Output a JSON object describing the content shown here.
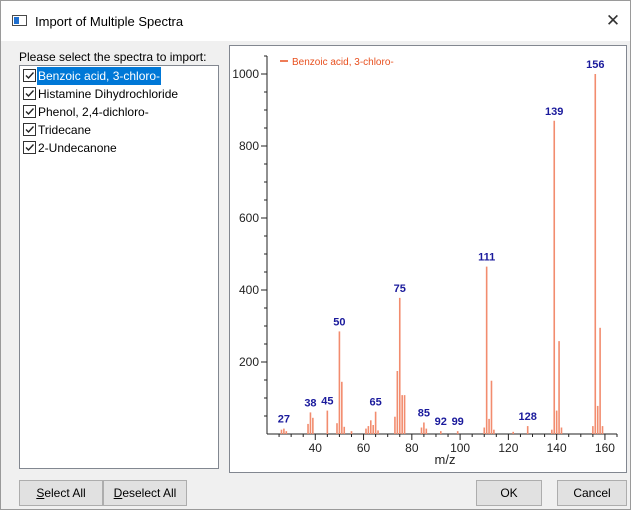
{
  "window": {
    "title": "Import of Multiple Spectra",
    "close_glyph": "✕"
  },
  "prompt": "Please select the spectra to import:",
  "spectra": [
    {
      "label": "Benzoic acid, 3-chloro-",
      "checked": true,
      "selected": true
    },
    {
      "label": "Histamine Dihydrochloride",
      "checked": true,
      "selected": false
    },
    {
      "label": "Phenol, 2,4-dichloro-",
      "checked": true,
      "selected": false
    },
    {
      "label": "Tridecane",
      "checked": true,
      "selected": false
    },
    {
      "label": "2-Undecanone",
      "checked": true,
      "selected": false
    }
  ],
  "buttons": {
    "select_all": {
      "accel": "S",
      "rest": "elect All"
    },
    "deselect_all": {
      "accel": "D",
      "rest": "eselect All"
    },
    "ok": "OK",
    "cancel": "Cancel"
  },
  "colors": {
    "accent": "#0078d7",
    "peak": "#f28c6e",
    "peak_label": "#1a1a9c",
    "legend": "#e8501f"
  },
  "chart_data": {
    "type": "bar",
    "legend": "Benzoic acid, 3-chloro-",
    "legend_placement": "top-left",
    "xlabel": "m/z",
    "ylabel": "",
    "xlim": [
      20,
      165
    ],
    "ylim": [
      0,
      1050
    ],
    "xticks": [
      40,
      60,
      80,
      100,
      120,
      140,
      160
    ],
    "yticks": [
      200,
      400,
      600,
      800,
      1000
    ],
    "grid": false,
    "peaks": [
      {
        "x": 26,
        "y": 12
      },
      {
        "x": 27,
        "y": 15
      },
      {
        "x": 28,
        "y": 8
      },
      {
        "x": 37,
        "y": 28
      },
      {
        "x": 38,
        "y": 60
      },
      {
        "x": 39,
        "y": 45
      },
      {
        "x": 45,
        "y": 65
      },
      {
        "x": 49,
        "y": 30
      },
      {
        "x": 50,
        "y": 285
      },
      {
        "x": 51,
        "y": 145
      },
      {
        "x": 52,
        "y": 20
      },
      {
        "x": 55,
        "y": 8
      },
      {
        "x": 61,
        "y": 15
      },
      {
        "x": 62,
        "y": 22
      },
      {
        "x": 63,
        "y": 38
      },
      {
        "x": 64,
        "y": 25
      },
      {
        "x": 65,
        "y": 62
      },
      {
        "x": 66,
        "y": 10
      },
      {
        "x": 73,
        "y": 48
      },
      {
        "x": 74,
        "y": 175
      },
      {
        "x": 75,
        "y": 378
      },
      {
        "x": 76,
        "y": 108
      },
      {
        "x": 77,
        "y": 108
      },
      {
        "x": 84,
        "y": 18
      },
      {
        "x": 85,
        "y": 32
      },
      {
        "x": 86,
        "y": 15
      },
      {
        "x": 92,
        "y": 8
      },
      {
        "x": 99,
        "y": 8
      },
      {
        "x": 110,
        "y": 18
      },
      {
        "x": 111,
        "y": 465
      },
      {
        "x": 112,
        "y": 42
      },
      {
        "x": 113,
        "y": 148
      },
      {
        "x": 114,
        "y": 12
      },
      {
        "x": 122,
        "y": 6
      },
      {
        "x": 128,
        "y": 22
      },
      {
        "x": 138,
        "y": 12
      },
      {
        "x": 139,
        "y": 870
      },
      {
        "x": 140,
        "y": 65
      },
      {
        "x": 141,
        "y": 258
      },
      {
        "x": 142,
        "y": 18
      },
      {
        "x": 155,
        "y": 22
      },
      {
        "x": 156,
        "y": 1000
      },
      {
        "x": 157,
        "y": 78
      },
      {
        "x": 158,
        "y": 295
      },
      {
        "x": 159,
        "y": 22
      }
    ],
    "annotations": [
      {
        "x": 27,
        "y": 15,
        "label": "27"
      },
      {
        "x": 38,
        "y": 60,
        "label": "38"
      },
      {
        "x": 45,
        "y": 65,
        "label": "45"
      },
      {
        "x": 50,
        "y": 285,
        "label": "50"
      },
      {
        "x": 65,
        "y": 62,
        "label": "65"
      },
      {
        "x": 75,
        "y": 378,
        "label": "75"
      },
      {
        "x": 85,
        "y": 32,
        "label": "85"
      },
      {
        "x": 92,
        "y": 8,
        "label": "92"
      },
      {
        "x": 99,
        "y": 8,
        "label": "99"
      },
      {
        "x": 111,
        "y": 465,
        "label": "111"
      },
      {
        "x": 128,
        "y": 22,
        "label": "128"
      },
      {
        "x": 139,
        "y": 870,
        "label": "139"
      },
      {
        "x": 156,
        "y": 1000,
        "label": "156"
      }
    ]
  }
}
